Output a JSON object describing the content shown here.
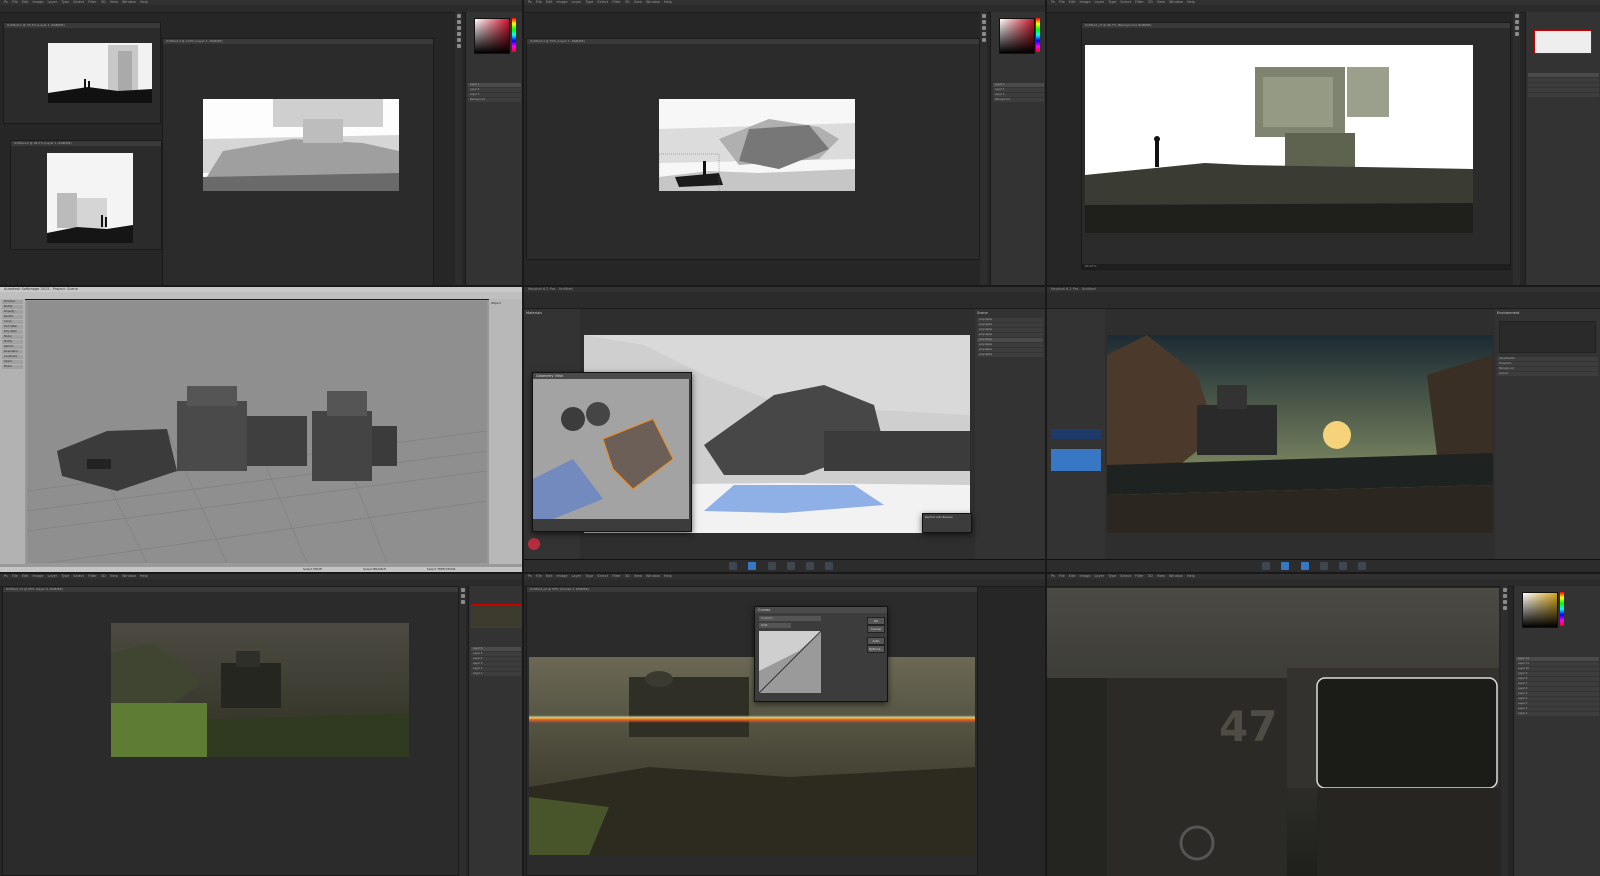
{
  "layout": "3x3 grid of application screenshots",
  "colors": {
    "bg": "#191919",
    "panel": "#262626",
    "accent_blue": "#3877c4",
    "sky_white": "#ffffff",
    "selection_orange": "#f08a1c"
  },
  "ps": {
    "menus": [
      "Ps",
      "File",
      "Edit",
      "Image",
      "Layer",
      "Type",
      "Select",
      "Filter",
      "3D",
      "View",
      "Window",
      "Help"
    ]
  },
  "panel1": {
    "tab_a": "Untitled-1 @ 33.3% (Layer 1, RGB/8#)",
    "tab_b": "Untitled-2 @ 66.7% (Layer 1, RGB/8#)",
    "tab_c": "Untitled-3 @ 100% (Layer 1, RGB/8#)",
    "layers": [
      "Layer 1",
      "Layer 2",
      "Layer 3",
      "Background"
    ]
  },
  "panel2": {
    "tab": "Untitled-4 @ 50% (Layer 1, RGB/8#)",
    "layers": [
      "Layer 1",
      "Layer 2",
      "Layer 3",
      "Background"
    ]
  },
  "panel3": {
    "tab": "Untitled_v3 @ 66.7% (Background, RGB/8#)",
    "status": "66.67%"
  },
  "panel4": {
    "title": "Autodesk SoftImage 2015 - Project: Scene",
    "left_menu": [
      "Primitive",
      "Modify",
      "Property",
      "Render",
      "Curve",
      "Surf. Mesh",
      "Poly. Mesh",
      "Model",
      "Modify",
      "Deform",
      "Kinematics",
      "Constraint",
      "Select",
      "Model"
    ],
    "right_header": "Object",
    "status_items": [
      "Select MOVE",
      "Select BRANCH",
      "Select TREE/CHAIN"
    ]
  },
  "panel5": {
    "title": "Keyshot 6.2 Pro - Untitled",
    "left_panel_title": "Materials",
    "dialog_title": "Geometry View",
    "right_panel_title": "Scene",
    "scene_items": [
      "polyobjets",
      "polyobjets",
      "polyobjets",
      "polyobjets",
      "polyobjets",
      "polyobjets",
      "polyobjets",
      "polyobjets"
    ],
    "notice": "KeyShot Auto Revision",
    "toolbar": [
      "Import",
      "Library",
      "Project",
      "Animation",
      "KeyShotVR",
      "Render"
    ]
  },
  "panel6": {
    "title": "Keyshot 6.2 Pro - Untitled",
    "right_panel_title": "Environment",
    "sections": [
      "Adjustments",
      "Transform",
      "Background",
      "Ground"
    ],
    "toolbar": [
      "Import",
      "Library",
      "Project",
      "Animation",
      "KeyShotVR",
      "Render"
    ]
  },
  "panel7": {
    "tab": "Untitled_v3 @ 25% (Layer 6, RGB/8#)",
    "layers": [
      "Layer 6",
      "Layer 5",
      "Layer 4",
      "Layer 3",
      "Layer 2",
      "Layer 1"
    ]
  },
  "panel8": {
    "tab": "Untitled_v4 @ 50% (Curves 1, RGB/8#)",
    "dialog_title": "Curves",
    "preset": "Custom",
    "channel": "RGB",
    "buttons": [
      "OK",
      "Cancel",
      "Auto",
      "Options..."
    ]
  },
  "panel9": {
    "tab": "Untitled_v5 @ 100% (Layer 12, RGB/8#)",
    "marking": "47",
    "layers": [
      "Layer 12",
      "Layer 11",
      "Layer 10",
      "Layer 9",
      "Layer 8",
      "Layer 7",
      "Layer 6",
      "Layer 5",
      "Layer 4",
      "Layer 3",
      "Layer 2",
      "Layer 1"
    ]
  }
}
